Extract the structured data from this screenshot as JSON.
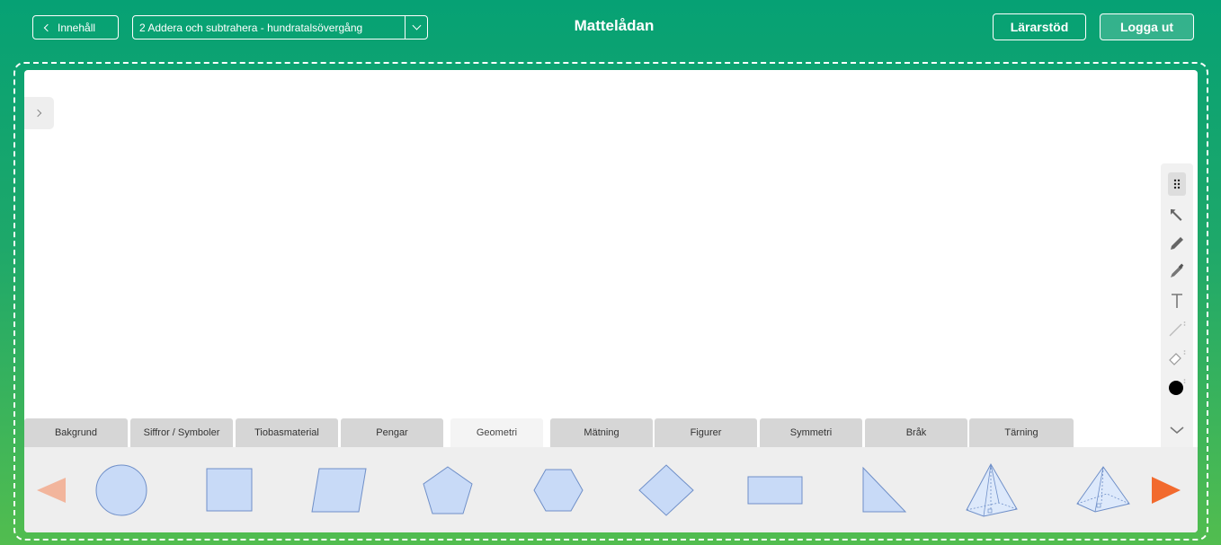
{
  "header": {
    "back_label": "Innehåll",
    "unit_selected": "2 Addera och subtrahera - hundratalsövergång",
    "title": "Mattelådan",
    "teacher_label": "Lärarstöd",
    "logout_label": "Logga ut"
  },
  "toolbar": {
    "tools": [
      "drag-grip-icon",
      "pointer-icon",
      "pencil-icon",
      "marker-icon",
      "text-icon",
      "line-icon",
      "eraser-icon",
      "color-dot-icon",
      "chevron-down-icon"
    ],
    "selected_color": "#000000"
  },
  "tabs": [
    {
      "label": "Bakgrund"
    },
    {
      "label": "Siffror / Symboler"
    },
    {
      "label": "Tiobasmaterial"
    },
    {
      "label": "Pengar"
    },
    {
      "label": "Geometri",
      "active": true
    },
    {
      "label": "Mätning"
    },
    {
      "label": "Figurer"
    },
    {
      "label": "Symmetri"
    },
    {
      "label": "Bråk"
    },
    {
      "label": "Tärning"
    }
  ],
  "shapes": [
    "circle",
    "square",
    "parallelogram",
    "pentagon",
    "hexagon",
    "rhombus",
    "rectangle",
    "right-triangle",
    "square-pyramid",
    "triangular-pyramid"
  ],
  "colors": {
    "shape_fill": "#c8daf7",
    "shape_stroke": "#6f8fc8",
    "arrow_active": "#f26a2e",
    "arrow_inactive": "#f2b59c"
  }
}
